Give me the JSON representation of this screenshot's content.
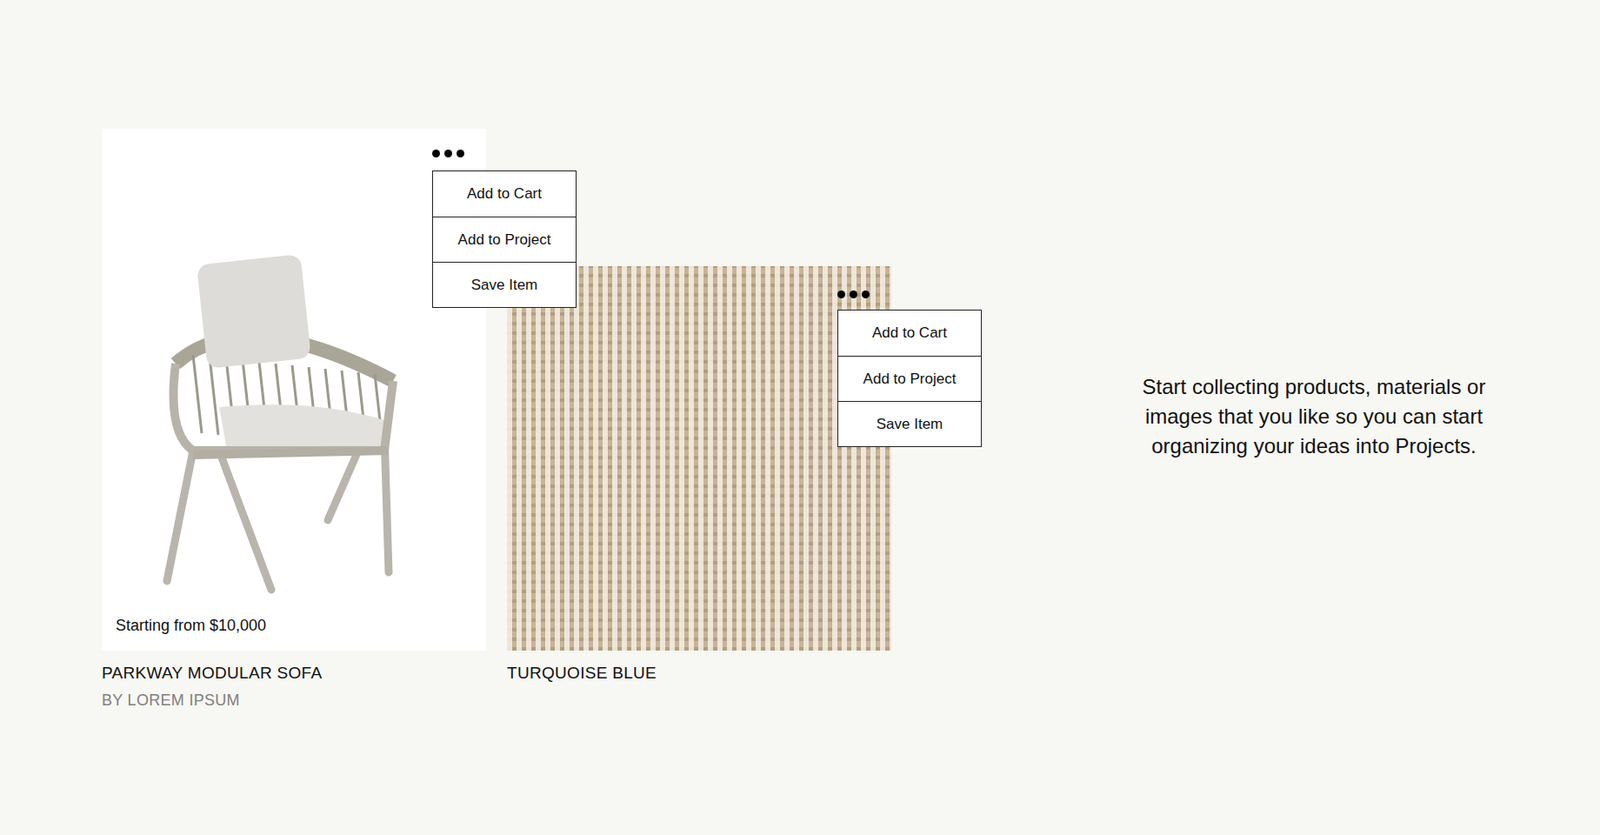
{
  "items": [
    {
      "kind": "product",
      "price": "Starting from $10,000",
      "title": "PARKWAY MODULAR SOFA",
      "byline": "BY LOREM IPSUM",
      "menu_open": true,
      "menu": [
        "Add to Cart",
        "Add to Project",
        "Save Item"
      ]
    },
    {
      "kind": "material",
      "title": "TURQUOISE BLUE",
      "menu_open": true,
      "menu": [
        "Add to Cart",
        "Add to Project",
        "Save Item"
      ]
    }
  ],
  "hint": "Start collecting products, materials or images that you like so you can start organizing your ideas into Projects."
}
